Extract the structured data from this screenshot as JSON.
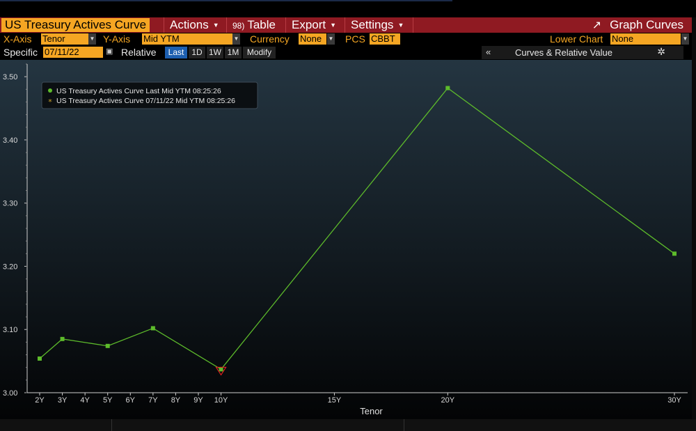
{
  "menu": {
    "title": "US Treasury Actives Curve",
    "actions": "Actions",
    "table": "Table",
    "table_icon": "98)",
    "export": "Export",
    "settings": "Settings",
    "graph_curves": "Graph Curves"
  },
  "controls": {
    "xaxis_label": "X-Axis",
    "xaxis_value": "Tenor",
    "yaxis_label": "Y-Axis",
    "yaxis_value": "Mid YTM",
    "currency_label": "Currency",
    "currency_value": "None",
    "pcs_label": "PCS",
    "pcs_value": "CBBT",
    "lower_chart_label": "Lower Chart",
    "lower_chart_value": "None",
    "specific_label": "Specific",
    "specific_date": "07/11/22",
    "relative_label": "Relative",
    "periods": [
      "Last",
      "1D",
      "1W",
      "1M",
      "Modify"
    ],
    "active_period": "Last",
    "panel_title": "Curves & Relative Value"
  },
  "colors": {
    "menu_bg": "#8f1a22",
    "accent": "#f5a623",
    "series_last": "#5dbb2b",
    "series_dated": "#c9a227",
    "marker_highlight": "#e02020"
  },
  "chart_data": {
    "type": "line",
    "xlabel": "Tenor",
    "ylabel": "",
    "categories": [
      "2Y",
      "3Y",
      "4Y",
      "5Y",
      "6Y",
      "7Y",
      "8Y",
      "9Y",
      "10Y",
      "15Y",
      "20Y",
      "30Y"
    ],
    "x_years": [
      2,
      3,
      4,
      5,
      6,
      7,
      8,
      9,
      10,
      15,
      20,
      30
    ],
    "ylim": [
      3.0,
      3.52
    ],
    "yticks": [
      "3.00",
      "3.10",
      "3.20",
      "3.30",
      "3.40",
      "3.50"
    ],
    "legend_position": "top-left",
    "series": [
      {
        "name": "US Treasury Actives Curve Last Mid YTM 08:25:26",
        "x": [
          2,
          3,
          5,
          7,
          10,
          20,
          30
        ],
        "values": [
          3.054,
          3.085,
          3.074,
          3.102,
          3.037,
          3.482,
          3.22
        ],
        "marker": "dot"
      },
      {
        "name": "US Treasury Actives Curve 07/11/22 Mid YTM 08:25:26",
        "x": [
          2,
          3,
          5,
          7,
          10,
          20,
          30
        ],
        "values": [
          3.054,
          3.085,
          3.074,
          3.102,
          3.037,
          3.482,
          3.22
        ],
        "marker": "star"
      }
    ]
  }
}
